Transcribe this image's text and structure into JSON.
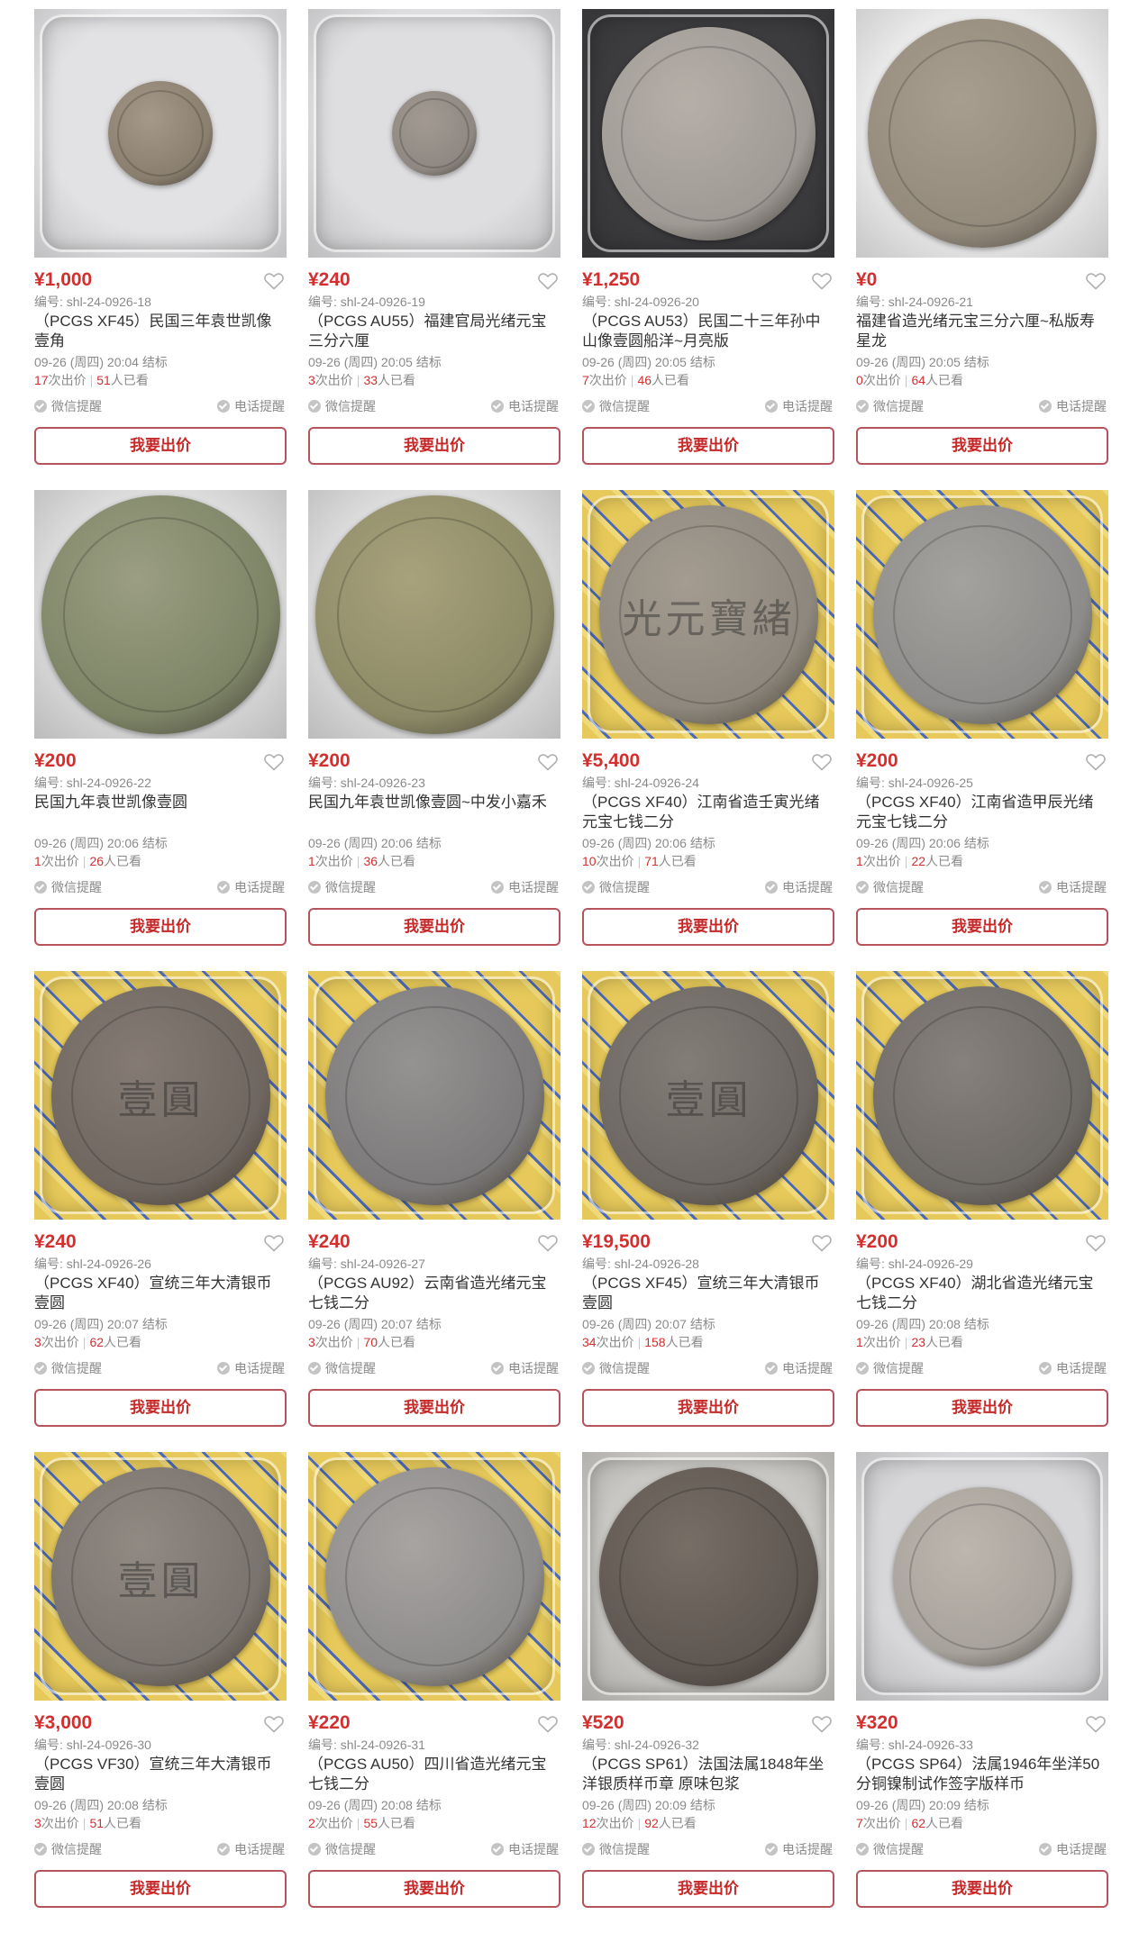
{
  "lots": [
    {
      "price": "¥1,000",
      "lot_no": "编号: shl-24-0926-18",
      "title": "（PCGS XF45）民国三年袁世凯像壹角",
      "end_time": "09-26 (周四) 20:04 结标",
      "bids": "17",
      "bids_suffix": "次出价",
      "views": "51",
      "views_suffix": "人已看",
      "wechat": "微信提醒",
      "phone": "电话提醒",
      "bid_button": "我要出价",
      "colors": {
        "bg": "#e2e2e4",
        "coin": "#8a7f6f",
        "inner": "#a5998a"
      },
      "slabbed": true,
      "coin_size": 0.42,
      "glyph": ""
    },
    {
      "price": "¥240",
      "lot_no": "编号: shl-24-0926-19",
      "title": "（PCGS AU55）福建官局光绪元宝三分六厘",
      "end_time": "09-26 (周四) 20:05 结标",
      "bids": "3",
      "bids_suffix": "次出价",
      "views": "33",
      "views_suffix": "人已看",
      "wechat": "微信提醒",
      "phone": "电话提醒",
      "bid_button": "我要出价",
      "colors": {
        "bg": "#dedee0",
        "coin": "#8f8882",
        "inner": "#a29a92"
      },
      "slabbed": true,
      "coin_size": 0.34,
      "glyph": ""
    },
    {
      "price": "¥1,250",
      "lot_no": "编号: shl-24-0926-20",
      "title": "（PCGS AU53）民国二十三年孙中山像壹圆船洋~月亮版",
      "end_time": "09-26 (周四) 20:05 结标",
      "bids": "7",
      "bids_suffix": "次出价",
      "views": "46",
      "views_suffix": "人已看",
      "wechat": "微信提醒",
      "phone": "电话提醒",
      "bid_button": "我要出价",
      "colors": {
        "bg": "#3c3b3e",
        "coin": "#9f9a94",
        "inner": "#b5afa8"
      },
      "slabbed": true,
      "coin_size": 0.86,
      "glyph": ""
    },
    {
      "price": "¥0",
      "lot_no": "编号: shl-24-0926-21",
      "title": "福建省造光绪元宝三分六厘~私版寿星龙",
      "end_time": "09-26 (周四) 20:05 结标",
      "bids": "0",
      "bids_suffix": "次出价",
      "views": "64",
      "views_suffix": "人已看",
      "wechat": "微信提醒",
      "phone": "电话提醒",
      "bid_button": "我要出价",
      "colors": {
        "bg": "#e9e9e9",
        "coin": "#938a7c",
        "inner": "#a89e90"
      },
      "slabbed": false,
      "coin_size": 0.92,
      "glyph": ""
    },
    {
      "price": "¥200",
      "lot_no": "编号: shl-24-0926-22",
      "title": "民国九年袁世凯像壹圆",
      "end_time": "09-26 (周四) 20:06 结标",
      "bids": "1",
      "bids_suffix": "次出价",
      "views": "26",
      "views_suffix": "人已看",
      "wechat": "微信提醒",
      "phone": "电话提醒",
      "bid_button": "我要出价",
      "colors": {
        "bg": "#dcdcdc",
        "coin": "#7d8466",
        "inner": "#9b9e82"
      },
      "slabbed": false,
      "coin_size": 0.96,
      "glyph": ""
    },
    {
      "price": "¥200",
      "lot_no": "编号: shl-24-0926-23",
      "title": "民国九年袁世凯像壹圆~中发小嘉禾",
      "end_time": "09-26 (周四) 20:06 结标",
      "bids": "1",
      "bids_suffix": "次出价",
      "views": "36",
      "views_suffix": "人已看",
      "wechat": "微信提醒",
      "phone": "电话提醒",
      "bid_button": "我要出价",
      "colors": {
        "bg": "#dcdcdc",
        "coin": "#8c8a66",
        "inner": "#a8a27c"
      },
      "slabbed": false,
      "coin_size": 0.96,
      "glyph": ""
    },
    {
      "price": "¥5,400",
      "lot_no": "编号: shl-24-0926-24",
      "title": "（PCGS XF40）江南省造壬寅光绪元宝七钱二分",
      "end_time": "09-26 (周四) 20:06 结标",
      "bids": "10",
      "bids_suffix": "次出价",
      "views": "71",
      "views_suffix": "人已看",
      "wechat": "微信提醒",
      "phone": "电话提醒",
      "bid_button": "我要出价",
      "colors": {
        "bg": "#e3c656",
        "coin": "#8e877d",
        "inner": "#a49c91"
      },
      "slabbed": true,
      "coin_size": 0.88,
      "glyph": "光元寶緒"
    },
    {
      "price": "¥200",
      "lot_no": "编号: shl-24-0926-25",
      "title": "（PCGS XF40）江南省造甲辰光绪元宝七钱二分",
      "end_time": "09-26 (周四) 20:06 结标",
      "bids": "1",
      "bids_suffix": "次出价",
      "views": "22",
      "views_suffix": "人已看",
      "wechat": "微信提醒",
      "phone": "电话提醒",
      "bid_button": "我要出价",
      "colors": {
        "bg": "#e3c656",
        "coin": "#8d8c8a",
        "inner": "#a3a29f"
      },
      "slabbed": true,
      "coin_size": 0.88,
      "glyph": ""
    },
    {
      "price": "¥240",
      "lot_no": "编号: shl-24-0926-26",
      "title": "（PCGS XF40）宣统三年大清银币壹圆",
      "end_time": "09-26 (周四) 20:07 结标",
      "bids": "3",
      "bids_suffix": "次出价",
      "views": "62",
      "views_suffix": "人已看",
      "wechat": "微信提醒",
      "phone": "电话提醒",
      "bid_button": "我要出价",
      "colors": {
        "bg": "#e3c656",
        "coin": "#6f6660",
        "inner": "#857b74"
      },
      "slabbed": true,
      "coin_size": 0.88,
      "glyph": "壹圓"
    },
    {
      "price": "¥240",
      "lot_no": "编号: shl-24-0926-27",
      "title": "（PCGS AU92）云南省造光绪元宝七钱二分",
      "end_time": "09-26 (周四) 20:07 结标",
      "bids": "3",
      "bids_suffix": "次出价",
      "views": "70",
      "views_suffix": "人已看",
      "wechat": "微信提醒",
      "phone": "电话提醒",
      "bid_button": "我要出价",
      "colors": {
        "bg": "#e3c656",
        "coin": "#7c7a7a",
        "inner": "#959292"
      },
      "slabbed": true,
      "coin_size": 0.88,
      "glyph": ""
    },
    {
      "price": "¥19,500",
      "lot_no": "编号: shl-24-0926-28",
      "title": "（PCGS XF45）宣统三年大清银币壹圆",
      "end_time": "09-26 (周四) 20:07 结标",
      "bids": "34",
      "bids_suffix": "次出价",
      "views": "158",
      "views_suffix": "人已看",
      "wechat": "微信提醒",
      "phone": "电话提醒",
      "bid_button": "我要出价",
      "colors": {
        "bg": "#e3c656",
        "coin": "#6b6661",
        "inner": "#837d77"
      },
      "slabbed": true,
      "coin_size": 0.88,
      "glyph": "壹圓"
    },
    {
      "price": "¥200",
      "lot_no": "编号: shl-24-0926-29",
      "title": "（PCGS XF40）湖北省造光绪元宝七钱二分",
      "end_time": "09-26 (周四) 20:08 结标",
      "bids": "1",
      "bids_suffix": "次出价",
      "views": "23",
      "views_suffix": "人已看",
      "wechat": "微信提醒",
      "phone": "电话提醒",
      "bid_button": "我要出价",
      "colors": {
        "bg": "#e3c656",
        "coin": "#6e6a66",
        "inner": "#86817c"
      },
      "slabbed": true,
      "coin_size": 0.88,
      "glyph": ""
    },
    {
      "price": "¥3,000",
      "lot_no": "编号: shl-24-0926-30",
      "title": "（PCGS VF30）宣统三年大清银币壹圆",
      "end_time": "09-26 (周四) 20:08 结标",
      "bids": "3",
      "bids_suffix": "次出价",
      "views": "51",
      "views_suffix": "人已看",
      "wechat": "微信提醒",
      "phone": "电话提醒",
      "bid_button": "我要出价",
      "colors": {
        "bg": "#e3c656",
        "coin": "#79736d",
        "inner": "#918a83"
      },
      "slabbed": true,
      "coin_size": 0.88,
      "glyph": "壹圓"
    },
    {
      "price": "¥220",
      "lot_no": "编号: shl-24-0926-31",
      "title": "（PCGS AU50）四川省造光绪元宝七钱二分",
      "end_time": "09-26 (周四) 20:08 结标",
      "bids": "2",
      "bids_suffix": "次出价",
      "views": "55",
      "views_suffix": "人已看",
      "wechat": "微信提醒",
      "phone": "电话提醒",
      "bid_button": "我要出价",
      "colors": {
        "bg": "#e3c656",
        "coin": "#8e8c8b",
        "inner": "#a7a4a2"
      },
      "slabbed": true,
      "coin_size": 0.88,
      "glyph": ""
    },
    {
      "price": "¥520",
      "lot_no": "编号: shl-24-0926-32",
      "title": "（PCGS SP61）法国法属1848年坐洋银质样币章 原味包浆",
      "end_time": "09-26 (周四) 20:09 结标",
      "bids": "12",
      "bids_suffix": "次出价",
      "views": "92",
      "views_suffix": "人已看",
      "wechat": "微信提醒",
      "phone": "电话提醒",
      "bid_button": "我要出价",
      "colors": {
        "bg": "#c9c7c3",
        "coin": "#5e5650",
        "inner": "#776e66"
      },
      "slabbed": true,
      "coin_size": 0.88,
      "glyph": ""
    },
    {
      "price": "¥320",
      "lot_no": "编号: shl-24-0926-33",
      "title": "（PCGS SP64）法属1946年坐洋50分铜镍制试作签字版样币",
      "end_time": "09-26 (周四) 20:09 结标",
      "bids": "7",
      "bids_suffix": "次出价",
      "views": "62",
      "views_suffix": "人已看",
      "wechat": "微信提醒",
      "phone": "电话提醒",
      "bid_button": "我要出价",
      "colors": {
        "bg": "#d7d7d9",
        "coin": "#a7a29b",
        "inner": "#bcb6ae"
      },
      "slabbed": true,
      "coin_size": 0.72,
      "glyph": ""
    }
  ],
  "theme": {
    "accent": "#d32f2f",
    "button_border": "#b5555b",
    "muted_text": "#8a8a8a"
  }
}
